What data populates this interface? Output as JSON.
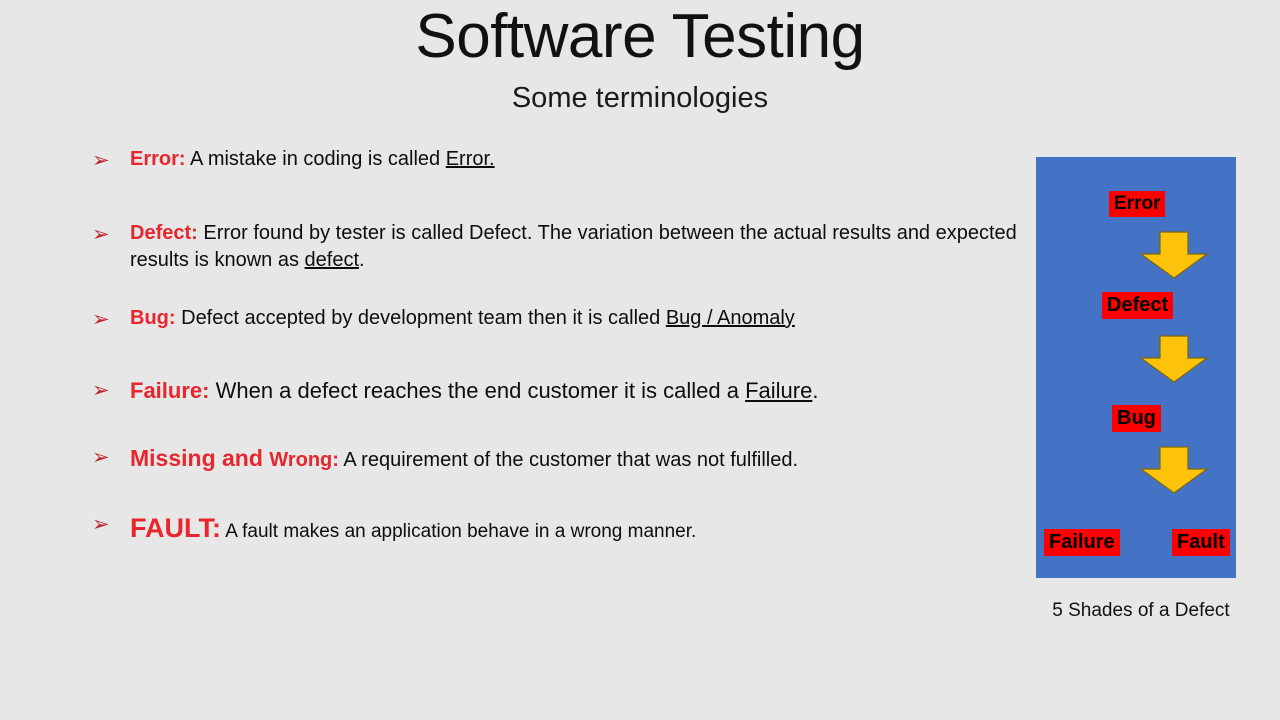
{
  "slide": {
    "title": "Software Testing",
    "subtitle": "Some terminologies",
    "background_color": "#e7e7e7",
    "accent_red": "#e8262d",
    "panel_blue": "#4472c4",
    "chip_red": "#fe0000",
    "arrow_gold": "#fdc20a"
  },
  "bullets": [
    {
      "marker": "➢",
      "term": "Error",
      "colon": ":",
      "body_before": " A mistake in coding is called ",
      "underlined": "Error.",
      "body_after": ""
    },
    {
      "marker": "➢",
      "term": "Defect",
      "colon": ":",
      "body_before": " Error found by tester is called Defect. The variation between the actual results and expected results is known as ",
      "underlined": "defect",
      "body_after": "."
    },
    {
      "marker": "➢",
      "term": "Bug",
      "colon": ":",
      "body_before": " Defect accepted by development team then it is called ",
      "underlined": "Bug / Anomaly",
      "body_after": ""
    },
    {
      "marker": "➢",
      "term": "Failure",
      "colon": ":",
      "body_before": " When a defect reaches the end customer it is called a ",
      "underlined": "Failure",
      "body_after": "."
    },
    {
      "marker": "➢",
      "term": "Missing and ",
      "term_secondary": "Wrong",
      "colon": ":",
      "body_before": " A requirement of the customer that was not fulfilled.",
      "underlined": "",
      "body_after": ""
    },
    {
      "marker": "➢",
      "term": "FAULT",
      "colon": ":",
      "body_before": " A fault makes an application behave in a wrong manner.",
      "underlined": "",
      "body_after": ""
    }
  ],
  "diagram": {
    "caption": "5 Shades of a Defect",
    "nodes": [
      {
        "label": "Error"
      },
      {
        "label": "Defect"
      },
      {
        "label": "Bug"
      },
      {
        "label": "Failure"
      },
      {
        "label": "Fault"
      }
    ],
    "arrows": [
      {
        "name": "arrow-error-to-defect"
      },
      {
        "name": "arrow-defect-to-bug"
      },
      {
        "name": "arrow-bug-to-outcomes"
      }
    ]
  }
}
